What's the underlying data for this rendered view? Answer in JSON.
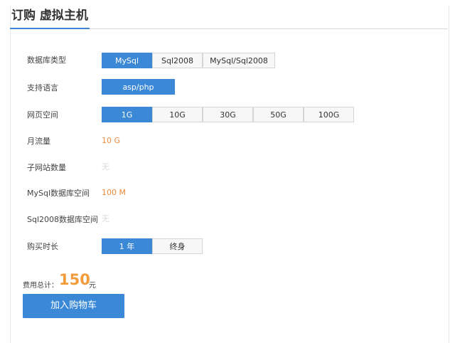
{
  "title": "订购 虚拟主机",
  "rows": [
    {
      "label": "数据库类型",
      "options": [
        "MySql",
        "Sql2008",
        "MySql/Sql2008"
      ],
      "selected": 0
    },
    {
      "label": "支持语言",
      "options": [
        "asp/php"
      ],
      "selected": 0
    },
    {
      "label": "网页空间",
      "options": [
        "1G",
        "10G",
        "30G",
        "50G",
        "100G"
      ],
      "selected": 0
    },
    {
      "label": "月流量",
      "value": "10 G"
    },
    {
      "label": "子网站数量",
      "value": "无"
    },
    {
      "label": "MySql数据库空间",
      "value": "100 M"
    },
    {
      "label": "Sql2008数据库空间",
      "value": "无"
    },
    {
      "label": "购买时长",
      "options": [
        "1 年",
        "终身"
      ],
      "selected": 0
    }
  ],
  "total": {
    "label": "费用总计：",
    "amount": "150",
    "unit": "元"
  },
  "cart_button": "加入购物车",
  "colors": {
    "accent": "#3a88d6",
    "price": "#f39b3b",
    "value": "#f08a3c"
  }
}
